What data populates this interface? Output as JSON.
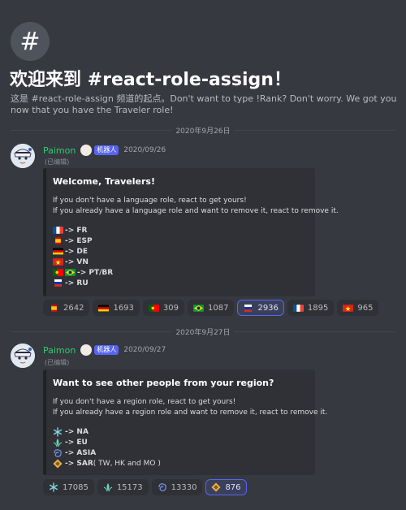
{
  "channel": {
    "icon": "hash-icon",
    "icon_glyph": "#",
    "welcome_title": "欢迎来到 #react-role-assign！",
    "welcome_desc": "这是 #react-role-assign 频道的起点。Don't want to type !Rank? Don't worry. We got you now that you have the Traveler role!"
  },
  "messages": [
    {
      "date_divider": "2020年9月26日",
      "username": "Paimon",
      "bot_tag": "机器人",
      "timestamp": "2020/09/26",
      "edited": "(已编辑)",
      "embed": {
        "title": "Welcome, Travelers!",
        "lines": [
          "If you don't have a language role, react to get yours!",
          "If you already have a language role and want to remove it, react to remove it."
        ],
        "roles": [
          {
            "icons": [
              "flag-fr-icon"
            ],
            "label": "-> FR"
          },
          {
            "icons": [
              "flag-es-icon"
            ],
            "label": "-> ESP"
          },
          {
            "icons": [
              "flag-de-icon"
            ],
            "label": "-> DE"
          },
          {
            "icons": [
              "flag-vn-icon"
            ],
            "label": "-> VN"
          },
          {
            "icons": [
              "flag-pt-icon",
              "flag-br-icon"
            ],
            "label": "-> PT/BR"
          },
          {
            "icons": [
              "flag-ru-icon"
            ],
            "label": "-> RU"
          }
        ]
      },
      "reactions": [
        {
          "icon": "flag-es-icon",
          "count": "2642",
          "active": false
        },
        {
          "icon": "flag-de-icon",
          "count": "1693",
          "active": false
        },
        {
          "icon": "flag-pt-icon",
          "count": "309",
          "active": false
        },
        {
          "icon": "flag-br-icon",
          "count": "1087",
          "active": false
        },
        {
          "icon": "flag-ru-icon",
          "count": "2936",
          "active": true
        },
        {
          "icon": "flag-fr-icon",
          "count": "1895",
          "active": false
        },
        {
          "icon": "flag-vn-icon",
          "count": "965",
          "active": false
        }
      ]
    },
    {
      "date_divider": "2020年9月27日",
      "username": "Paimon",
      "bot_tag": "机器人",
      "timestamp": "2020/09/27",
      "edited": "(已编辑)",
      "embed": {
        "title": "Want to see other people from your region?",
        "lines": [
          "If you don't have a region role, react to get yours!",
          "If you already have a region role and want to remove it, react to remove it."
        ],
        "roles": [
          {
            "icons": [
              "cryo-icon"
            ],
            "label": "-> NA"
          },
          {
            "icons": [
              "anemo-icon"
            ],
            "label": "-> EU"
          },
          {
            "icons": [
              "hydro-icon"
            ],
            "label": "-> ASIA"
          },
          {
            "icons": [
              "geo-icon"
            ],
            "label": "-> SAR",
            "suffix": " ( TW, HK and MO )"
          }
        ]
      },
      "reactions": [
        {
          "icon": "cryo-icon",
          "count": "17085",
          "active": false
        },
        {
          "icon": "anemo-icon",
          "count": "15173",
          "active": false
        },
        {
          "icon": "hydro-icon",
          "count": "13330",
          "active": false
        },
        {
          "icon": "geo-icon",
          "count": "876",
          "active": true
        }
      ]
    }
  ],
  "colors": {
    "background": "#36393f",
    "embed_bg": "#2f3136",
    "username": "#2ecc71",
    "bot_tag": "#5865f2",
    "active_reaction_border": "#5865f2"
  }
}
